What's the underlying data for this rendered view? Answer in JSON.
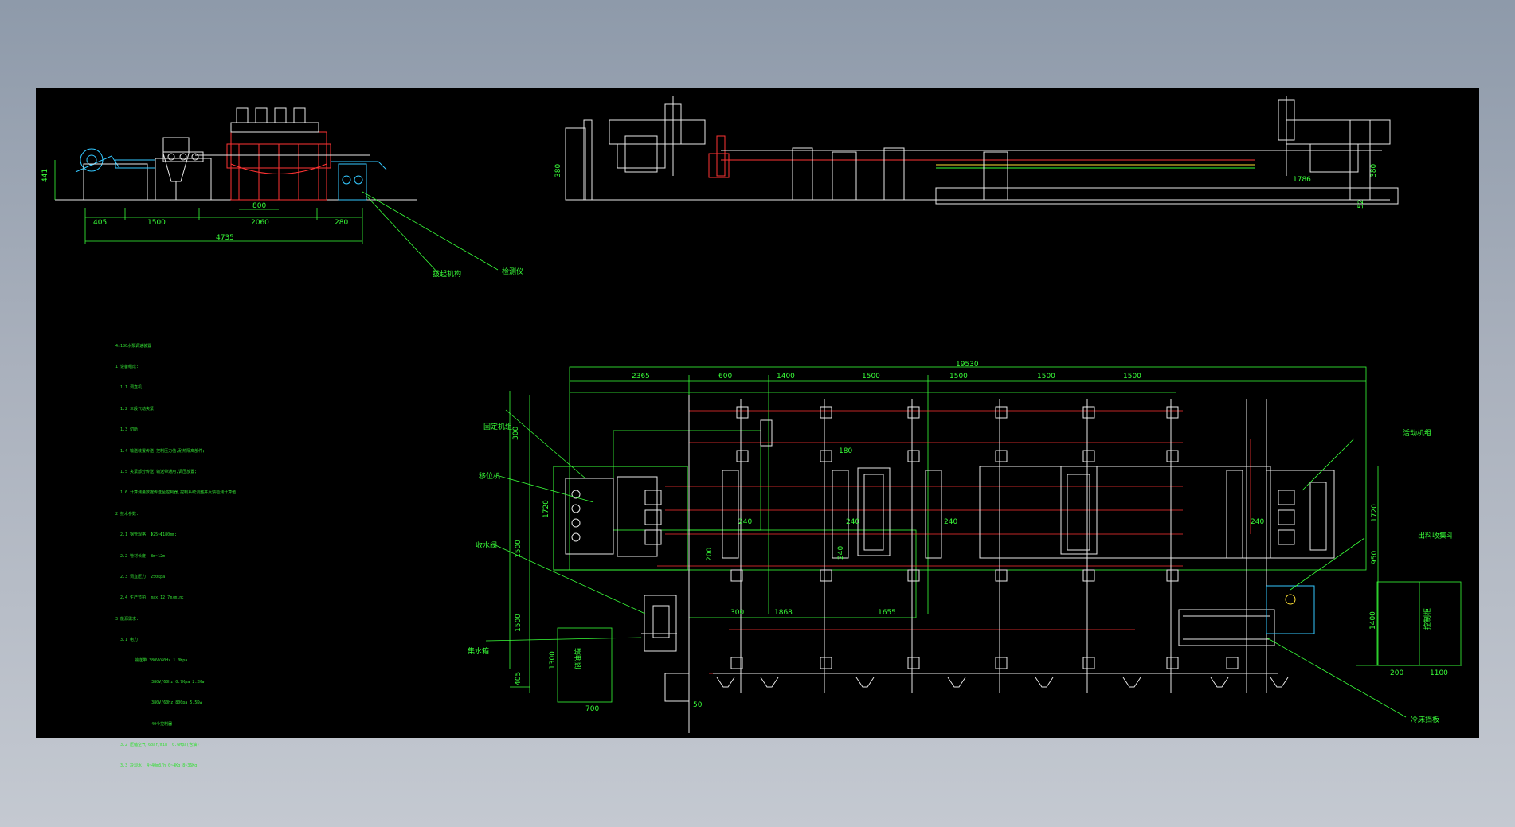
{
  "colors": {
    "background": "#8e9aaa",
    "canvas": "#000000",
    "green": "#33ff33",
    "white": "#e8e8e8",
    "red": "#ff3333",
    "yellow": "#ffe033",
    "cyan": "#33c8ff",
    "magenta": "#ff33ff"
  },
  "side_view_left": {
    "dims": {
      "height": "441",
      "d1": "405",
      "d2": "1500",
      "d3": "2060",
      "d4": "280",
      "d5": "800",
      "total": "4735"
    },
    "labels": {
      "a": "拔起机构",
      "b": "检测仪"
    }
  },
  "side_view_right": {
    "dims": {
      "h_left": "380",
      "h_right": "380",
      "span": "1786",
      "small": "52"
    }
  },
  "notes": [
    "4×180水泵调速装置",
    "1.设备组成:",
    "  1.1 调直机;",
    "  1.2 三段气动夹紧;",
    "  1.3 切断;",
    "  1.4 输送装置传送,控制压力值,耐热隔离部件;",
    "  1.5 夹紧部分传送,输送带通用,调压放置;",
    "  1.6 计算测量数据传送至控制器,控制系统调整并反馈检测计算值;",
    "2.技术参数:",
    "  2.1 钢管规格: Φ25~Φ180mm;",
    "  2.2 管材长度: 8m~12m;",
    "  2.3 调直压力: 250kpa;",
    "  2.4 生产节拍: max.12.7m/min;",
    "3.能源需求:",
    "  3.1 电力:",
    "        输送带 380V/60Hz 1.0Kpa",
    "               380V/60Hz 0.7Kpa 2.2Kw",
    "               380V/60Hz 800pa 5.5Kw",
    "               40个控制器",
    "  3.2 压缩空气 6bar/min  0.6Mpa(含油)",
    "  3.3 冷却水: 4~40m3/h 0~4Kg 8~36Kg"
  ],
  "plan_view": {
    "dims": {
      "total": "19530",
      "s1": "2365",
      "s2": "600",
      "s3": "1400",
      "s4": "1500",
      "s5": "1500",
      "s6": "1500",
      "s7": "1500",
      "v1": "300",
      "v2": "1720",
      "v3": "1500",
      "v4": "1500",
      "v5": "1300",
      "v6": "405",
      "b1": "180",
      "b2": "240",
      "b3": "240",
      "b4": "240",
      "b5": "240",
      "b6": "240",
      "b7": "200",
      "b8": "300",
      "c1": "1868",
      "c2": "1655",
      "c3": "700",
      "c4": "50",
      "r1": "1720",
      "r2": "950",
      "r3": "1400",
      "r4": "200",
      "r5": "1100"
    },
    "labels": {
      "fixed": "固定机组",
      "shift": "移位机",
      "water": "收水阀",
      "pump": "集水箱",
      "tank": "储油箱",
      "movable": "活动机组",
      "flat": "出料收集斗",
      "end": "冷床挡板",
      "box": "控制柜"
    }
  }
}
